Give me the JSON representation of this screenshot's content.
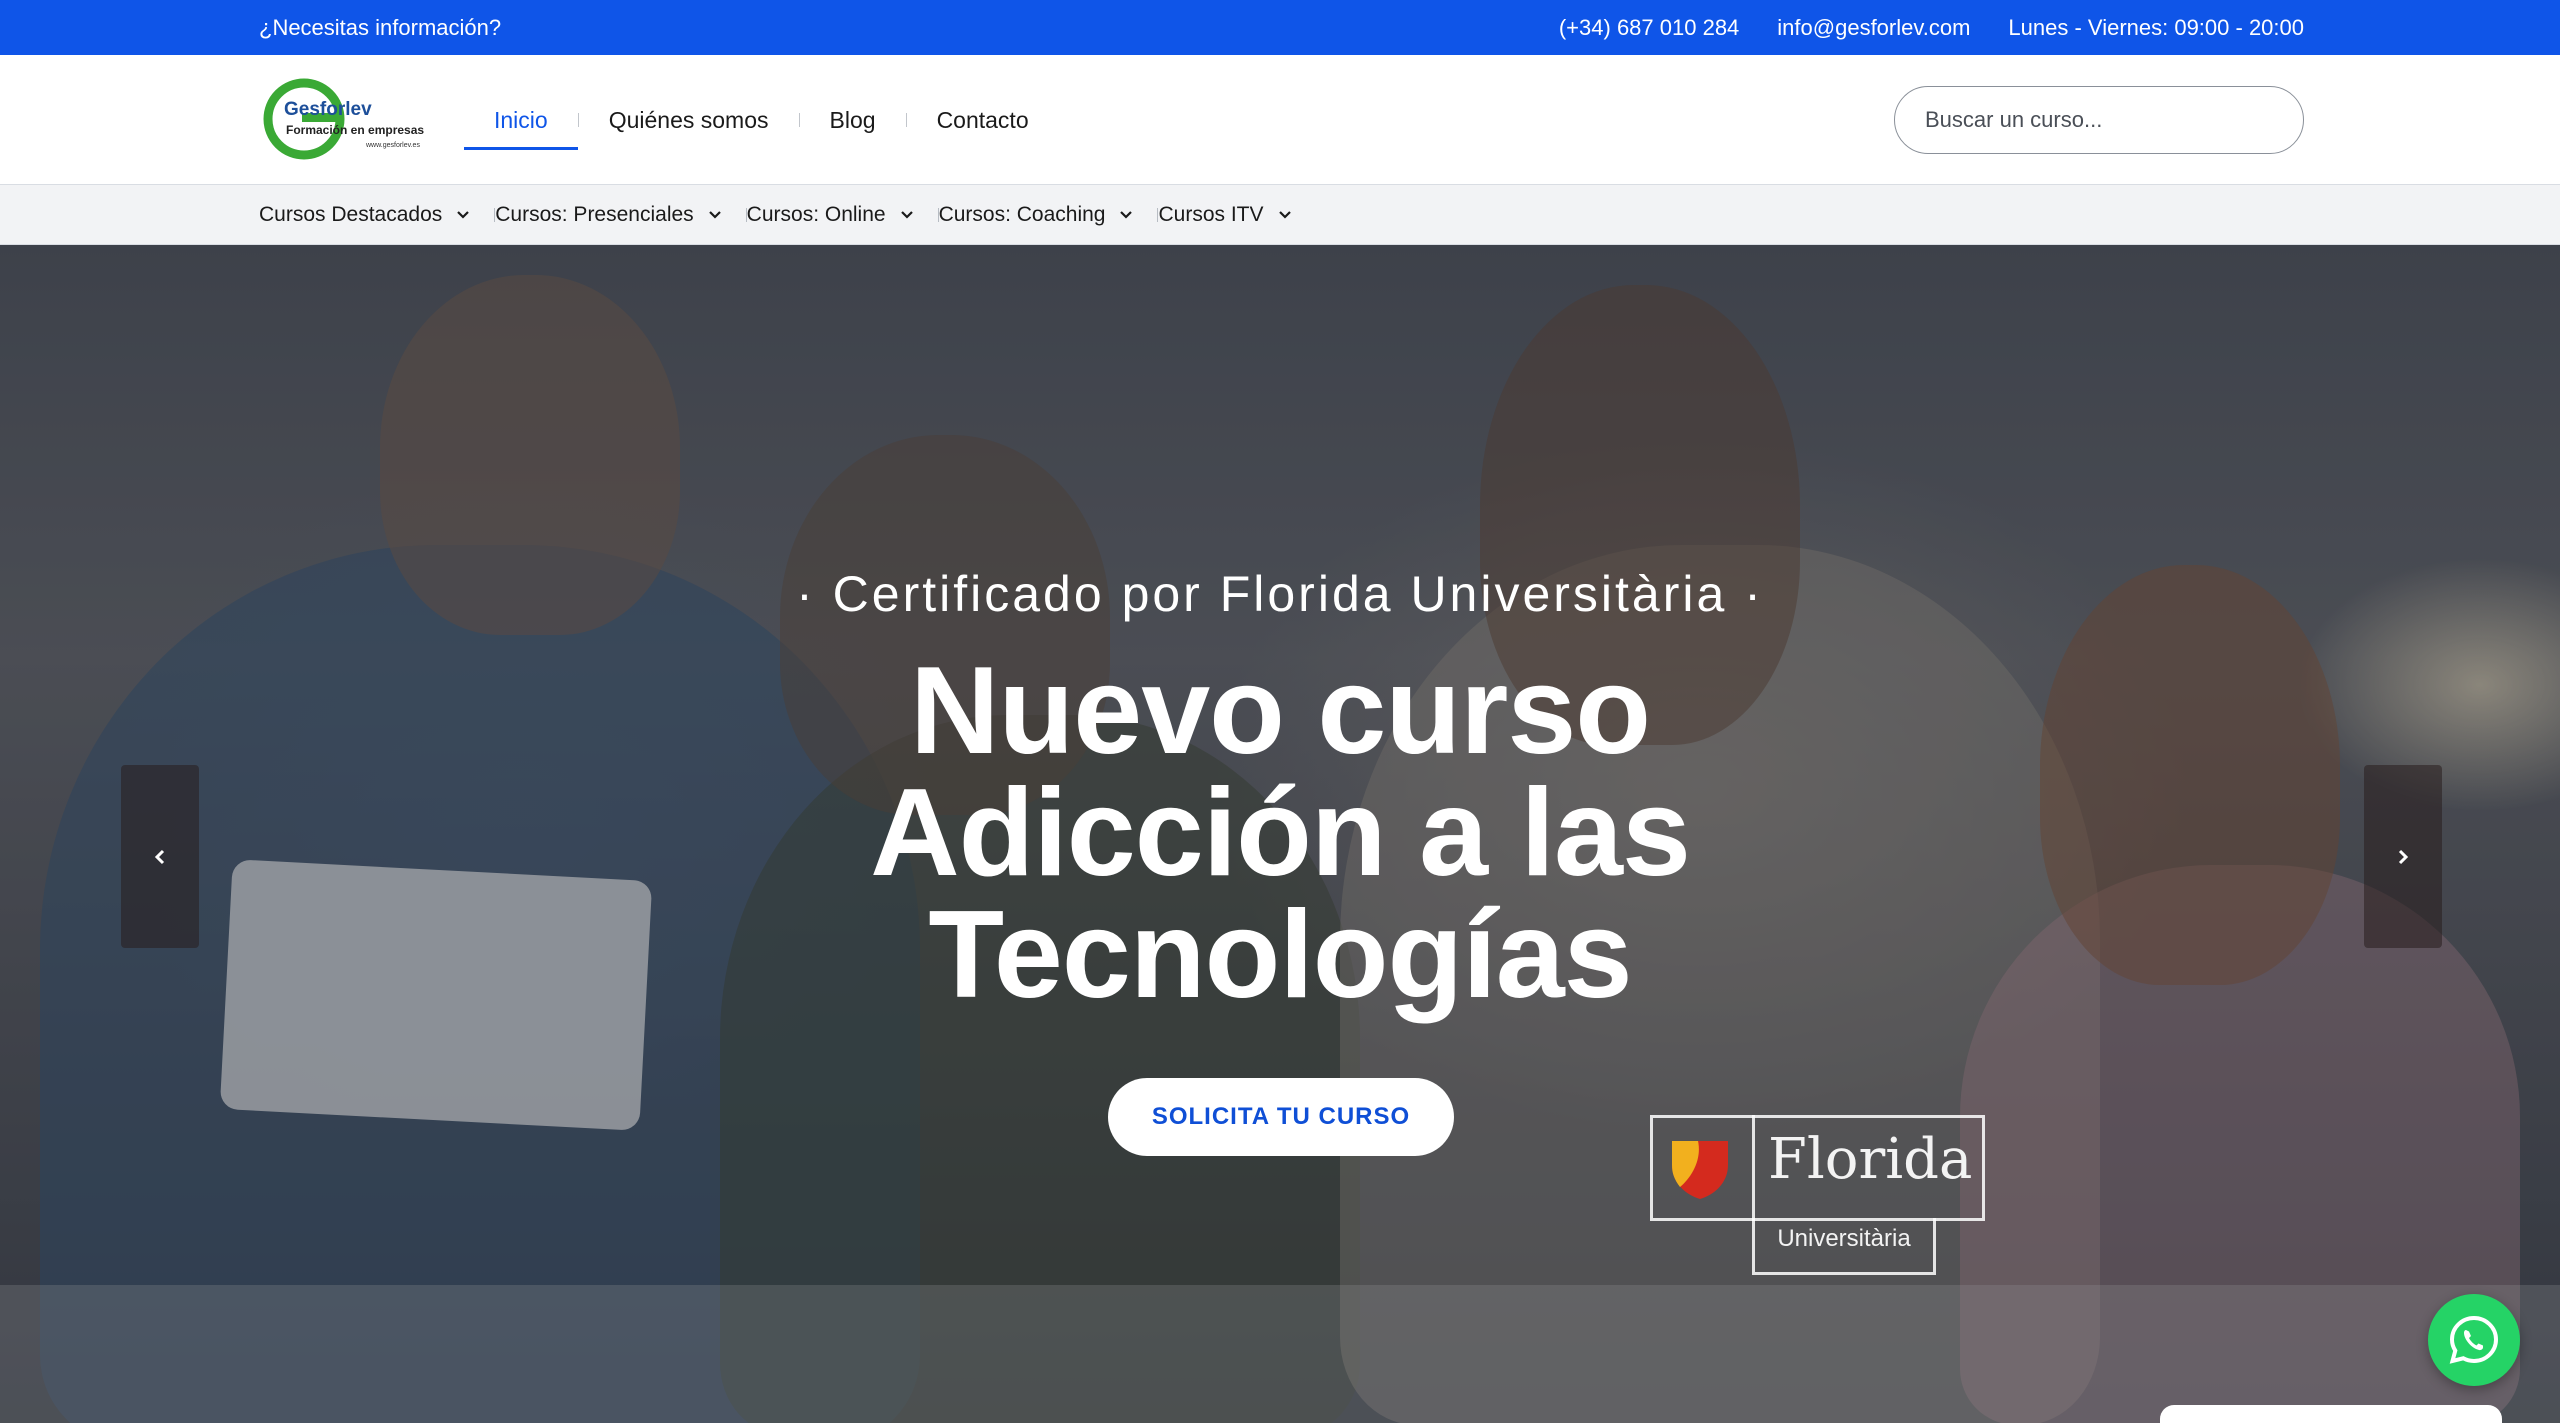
{
  "topbar": {
    "info_label": "¿Necesitas información?",
    "phone": "(+34) 687 010 284",
    "email": "info@gesforlev.com",
    "hours": "Lunes - Viernes: 09:00 - 20:00"
  },
  "header": {
    "logo": {
      "name": "Gesforlev",
      "tagline": "Formación en empresas",
      "url": "www.gesforlev.es"
    },
    "nav": [
      {
        "label": "Inicio",
        "active": true
      },
      {
        "label": "Quiénes somos",
        "active": false
      },
      {
        "label": "Blog",
        "active": false
      },
      {
        "label": "Contacto",
        "active": false
      }
    ],
    "search_placeholder": "Buscar un curso..."
  },
  "categories": [
    {
      "label": "Cursos Destacados",
      "icon": "chevron-down-icon"
    },
    {
      "label": "Cursos: Presenciales",
      "icon": "chevron-down-icon"
    },
    {
      "label": "Cursos: Online",
      "icon": "chevron-down-icon"
    },
    {
      "label": "Cursos: Coaching",
      "icon": "chevron-down-icon"
    },
    {
      "label": "Cursos ITV",
      "icon": "chevron-down-icon"
    }
  ],
  "hero": {
    "eyebrow": "· Certificado por Florida Universitària ·",
    "title_lines": [
      "Nuevo curso",
      "Adicción a las",
      "Tecnologías"
    ],
    "cta_label": "SOLICITA TU CURSO",
    "badge": {
      "name": "Florida",
      "sub": "Universitària"
    }
  },
  "controls": {
    "prev_icon": "chevron-left-icon",
    "next_icon": "chevron-right-icon",
    "whatsapp_icon": "whatsapp-icon"
  },
  "colors": {
    "brand_blue": "#0f55e8",
    "cta_text": "#0f4fd6",
    "whatsapp_green": "#25d366",
    "logo_green": "#3aa935"
  }
}
